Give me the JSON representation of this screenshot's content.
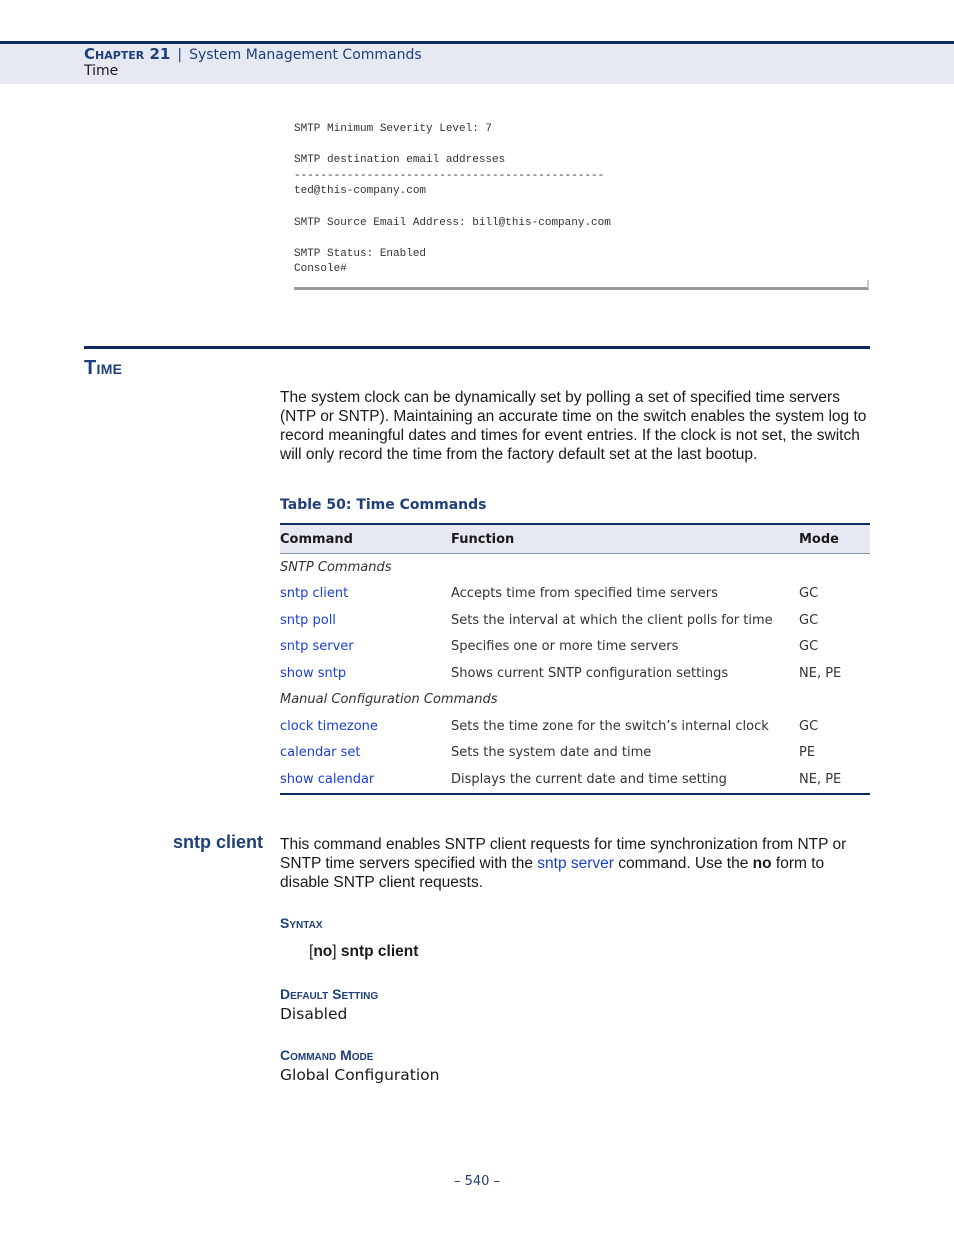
{
  "header": {
    "chapter": "Chapter 21",
    "separator": "|",
    "chapter_title": "System Management Commands",
    "section": "Time"
  },
  "code_example": {
    "lines": [
      "SMTP Minimum Severity Level: 7",
      "",
      "SMTP destination email addresses",
      "-----------------------------------------------",
      "ted@this-company.com",
      "",
      "SMTP Source Email Address: bill@this-company.com",
      "",
      "SMTP Status: Enabled",
      "Console#"
    ]
  },
  "section": {
    "title": "Time",
    "intro": "The system clock can be dynamically set by polling a set of specified time servers (NTP or SNTP). Maintaining an accurate time on the switch enables the system log to record meaningful dates and times for event entries. If the clock is not set, the switch will only record the time from the factory default set at the last bootup."
  },
  "table": {
    "caption": "Table 50: Time Commands",
    "headers": [
      "Command",
      "Function",
      "Mode"
    ],
    "groups": [
      {
        "label": "SNTP Commands",
        "rows": [
          {
            "command": "sntp client",
            "function": "Accepts time from specified time servers",
            "mode": "GC"
          },
          {
            "command": "sntp poll",
            "function": "Sets the interval at which the client polls for time",
            "mode": "GC"
          },
          {
            "command": "sntp server",
            "function": "Specifies one or more time servers",
            "mode": "GC"
          },
          {
            "command": "show sntp",
            "function": "Shows current SNTP configuration settings",
            "mode": "NE, PE"
          }
        ]
      },
      {
        "label": "Manual Configuration Commands",
        "rows": [
          {
            "command": "clock timezone",
            "function": "Sets the time zone for the switch’s internal clock",
            "mode": "GC"
          },
          {
            "command": "calendar set",
            "function": "Sets the system date and time",
            "mode": "PE"
          },
          {
            "command": "show calendar",
            "function": "Displays the current date and time setting",
            "mode": "NE, PE"
          }
        ]
      }
    ]
  },
  "command": {
    "name": "sntp client",
    "desc_part1": "This command enables SNTP client requests for time synchronization from NTP or SNTP time servers specified with the ",
    "desc_link": "sntp server",
    "desc_part2": " command. Use the ",
    "desc_bold": "no",
    "desc_part3": " form to disable SNTP client requests.",
    "syntax_heading": "Syntax",
    "syntax_open": "[",
    "syntax_no": "no",
    "syntax_close": "] ",
    "syntax_cmd": "sntp client",
    "default_heading": "Default Setting",
    "default_value": "Disabled",
    "mode_heading": "Command Mode",
    "mode_value": "Global Configuration"
  },
  "footer": {
    "page_number": "–  540  –"
  }
}
